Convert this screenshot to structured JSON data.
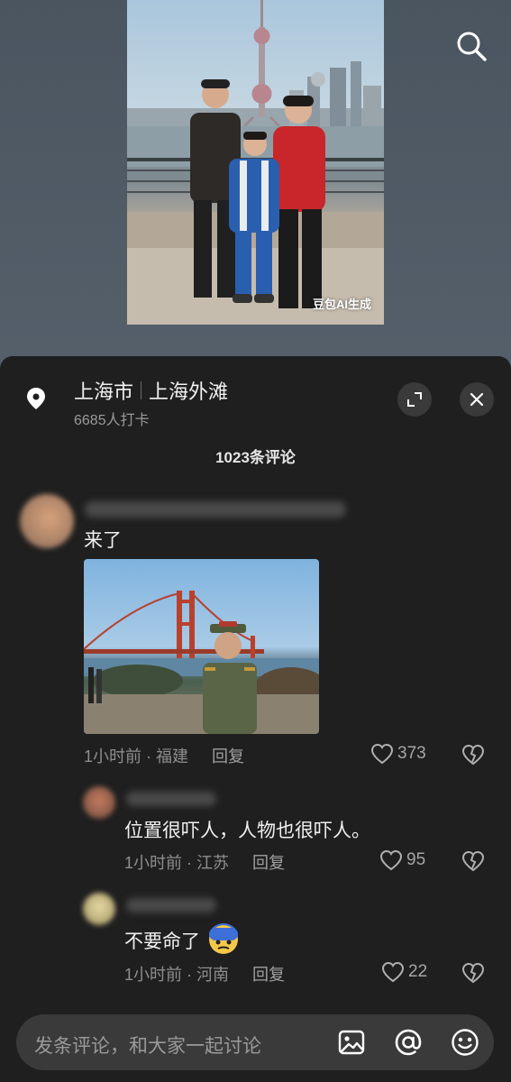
{
  "top_image": {
    "watermark": "豆包AI生成"
  },
  "location": {
    "city": "上海市",
    "place": "上海外滩",
    "checkins": "6685人打卡"
  },
  "comments_header": "1023条评论",
  "comments": [
    {
      "text": "来了",
      "time_place": "1小时前 · 福建",
      "reply": "回复",
      "likes": "373"
    },
    {
      "text": "位置很吓人，人物也很吓人。",
      "time_place": "1小时前 · 江苏",
      "reply": "回复",
      "likes": "95"
    },
    {
      "text": "不要命了",
      "time_place": "1小时前 · 河南",
      "reply": "回复",
      "likes": "22"
    }
  ],
  "input": {
    "placeholder": "发条评论，和大家一起讨论"
  },
  "icons": [
    "search-icon",
    "location-pin-icon",
    "expand-icon",
    "close-icon",
    "heart-icon",
    "broken-heart-icon",
    "image-icon",
    "at-icon",
    "emoji-icon"
  ],
  "colors": {
    "sheet_bg": "#1f1f1f",
    "input_bg": "#3a3a3a",
    "muted_text": "#8e8e8e"
  }
}
